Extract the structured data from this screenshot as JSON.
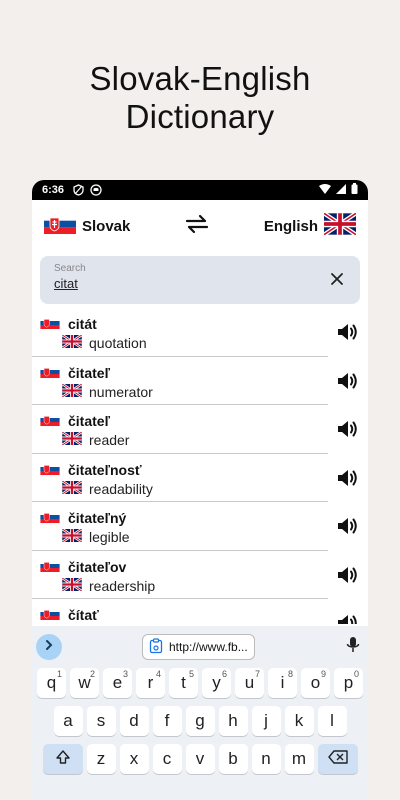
{
  "headline": {
    "line1": "Slovak-English",
    "line2": "Dictionary"
  },
  "statusbar": {
    "time": "6:36"
  },
  "langbar": {
    "source": "Slovak",
    "target": "English"
  },
  "search": {
    "placeholder": "Search",
    "value": "citat"
  },
  "results": [
    {
      "sk": "citát",
      "en": "quotation"
    },
    {
      "sk": "čitateľ",
      "en": "numerator"
    },
    {
      "sk": "čitateľ",
      "en": "reader"
    },
    {
      "sk": "čitateľnosť",
      "en": "readability"
    },
    {
      "sk": "čitateľný",
      "en": "legible"
    },
    {
      "sk": "čitateľov",
      "en": "readership"
    },
    {
      "sk": "čítať",
      "en": ""
    }
  ],
  "keyboard": {
    "suggestion": "http://www.fb...",
    "row1": [
      {
        "k": "q",
        "s": "1"
      },
      {
        "k": "w",
        "s": "2"
      },
      {
        "k": "e",
        "s": "3"
      },
      {
        "k": "r",
        "s": "4"
      },
      {
        "k": "t",
        "s": "5"
      },
      {
        "k": "y",
        "s": "6"
      },
      {
        "k": "u",
        "s": "7"
      },
      {
        "k": "i",
        "s": "8"
      },
      {
        "k": "o",
        "s": "9"
      },
      {
        "k": "p",
        "s": "0"
      }
    ],
    "row2": [
      "a",
      "s",
      "d",
      "f",
      "g",
      "h",
      "j",
      "k",
      "l"
    ],
    "row3": [
      "z",
      "x",
      "c",
      "v",
      "b",
      "n",
      "m"
    ]
  },
  "colors": {
    "background": "#f2efec",
    "search_bg": "#dfe4ed",
    "keyboard_bg": "#edf0f5",
    "accent": "#a9d3f6"
  }
}
